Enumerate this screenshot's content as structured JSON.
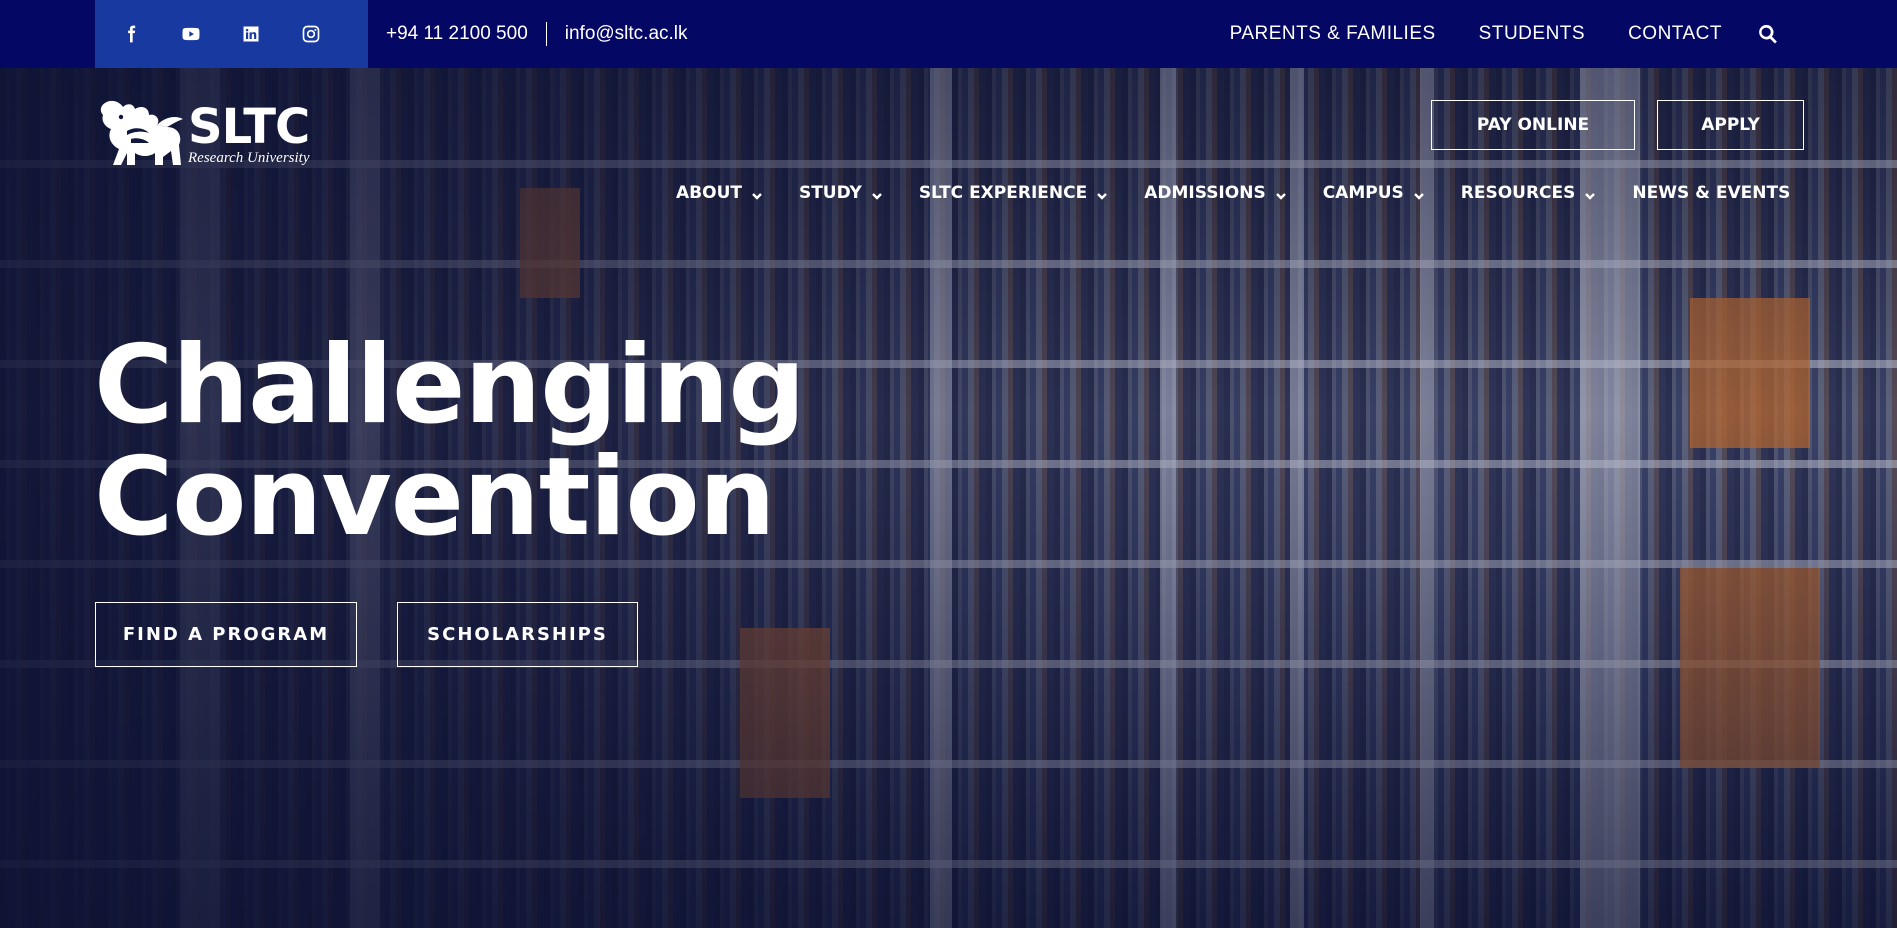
{
  "topbar": {
    "social": [
      {
        "name": "facebook-icon"
      },
      {
        "name": "youtube-icon"
      },
      {
        "name": "linkedin-icon"
      },
      {
        "name": "instagram-icon"
      }
    ],
    "phone": "+94 11 2100 500",
    "email": "info@sltc.ac.lk",
    "links": [
      "PARENTS & FAMILIES",
      "STUDENTS",
      "CONTACT"
    ],
    "search_icon": "search-icon"
  },
  "header": {
    "logo": {
      "name": "SLTC",
      "subtitle": "Research University"
    },
    "pay_online_label": "PAY ONLINE",
    "apply_label": "APPLY",
    "nav": [
      {
        "label": "ABOUT",
        "has_dropdown": true
      },
      {
        "label": "STUDY",
        "has_dropdown": true
      },
      {
        "label": "SLTC EXPERIENCE",
        "has_dropdown": true
      },
      {
        "label": "ADMISSIONS",
        "has_dropdown": true
      },
      {
        "label": "CAMPUS",
        "has_dropdown": true
      },
      {
        "label": "RESOURCES",
        "has_dropdown": true
      },
      {
        "label": "NEWS & EVENTS",
        "has_dropdown": false
      }
    ]
  },
  "hero": {
    "headline_line1": "Challenging",
    "headline_line2": "Convention",
    "find_program_label": "FIND A PROGRAM",
    "scholarships_label": "SCHOLARSHIPS"
  },
  "colors": {
    "topbar_bg": "#050764",
    "social_bg": "#183aa0",
    "text": "#ffffff"
  }
}
